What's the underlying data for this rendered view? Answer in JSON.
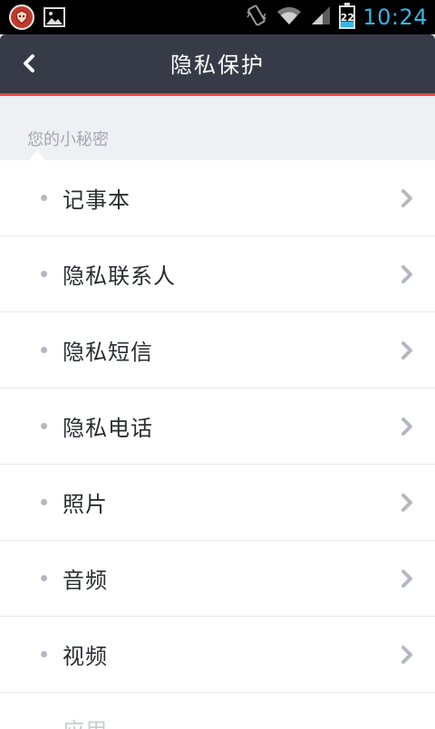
{
  "status_bar": {
    "battery_level": "22",
    "time": "10:24",
    "icons": [
      "app-shield-icon",
      "image-icon",
      "vibrate-icon",
      "wifi-icon",
      "signal-icon",
      "battery-icon"
    ]
  },
  "header": {
    "title": "隐私保护",
    "back_icon": "chevron-left-icon"
  },
  "section": {
    "label": "您的小秘密"
  },
  "list": {
    "items": [
      {
        "label": "记事本"
      },
      {
        "label": "隐私联系人"
      },
      {
        "label": "隐私短信"
      },
      {
        "label": "隐私电话"
      },
      {
        "label": "照片"
      },
      {
        "label": "音频"
      },
      {
        "label": "视频"
      },
      {
        "label": "应用"
      }
    ]
  },
  "colors": {
    "status_bar_bg": "#000000",
    "status_accent": "#33b5e5",
    "header_bg": "#363b47",
    "header_accent_line": "#e8483b",
    "page_bg": "#eef0f4",
    "section_label": "#a3a7b0",
    "item_text": "#2b2d31",
    "chevron": "#b5b8bf"
  }
}
